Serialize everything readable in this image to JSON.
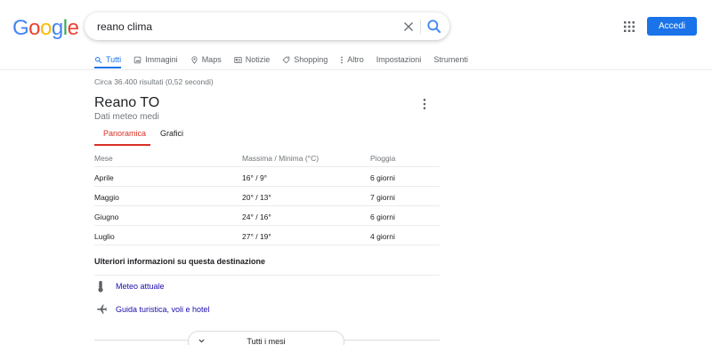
{
  "logo": {
    "letters": [
      "G",
      "o",
      "o",
      "g",
      "l",
      "e"
    ],
    "colors": [
      "#4285f4",
      "#ea4335",
      "#fbbc05",
      "#4285f4",
      "#34a853",
      "#ea4335"
    ]
  },
  "search": {
    "query": "reano clima"
  },
  "header": {
    "signin_label": "Accedi"
  },
  "tabs": [
    {
      "label": "Tutti",
      "icon": "search-icon",
      "active": true
    },
    {
      "label": "Immagini",
      "icon": "image-icon"
    },
    {
      "label": "Maps",
      "icon": "map-pin-icon"
    },
    {
      "label": "Notizie",
      "icon": "news-icon"
    },
    {
      "label": "Shopping",
      "icon": "tag-icon"
    },
    {
      "label": "Altro",
      "icon": "more-vert-icon"
    },
    {
      "label": "Impostazioni"
    },
    {
      "label": "Strumenti"
    }
  ],
  "stats": "Circa 36.400 risultati (0,52 secondi)",
  "weather": {
    "place": "Reano TO",
    "subtitle": "Dati meteo medi",
    "tabs": [
      "Panoramica",
      "Grafici"
    ],
    "columns": [
      "Mese",
      "Massima / Minima (°C)",
      "Pioggia"
    ],
    "rows": [
      [
        "Aprile",
        "16° / 9°",
        "6 giorni"
      ],
      [
        "Maggio",
        "20° / 13°",
        "7 giorni"
      ],
      [
        "Giugno",
        "24° / 16°",
        "6 giorni"
      ],
      [
        "Luglio",
        "27° / 19°",
        "4 giorni"
      ]
    ],
    "more_info_title": "Ulteriori informazioni su questa destinazione",
    "links": [
      {
        "label": "Meteo attuale",
        "icon": "thermometer-icon"
      },
      {
        "label": "Guida turistica, voli e hotel",
        "icon": "airplane-icon"
      }
    ],
    "all_months_label": "Tutti i mesi"
  },
  "colors": {
    "accent": "#1a73e8",
    "weather_accent": "#d93025",
    "link": "#1a0dab"
  }
}
